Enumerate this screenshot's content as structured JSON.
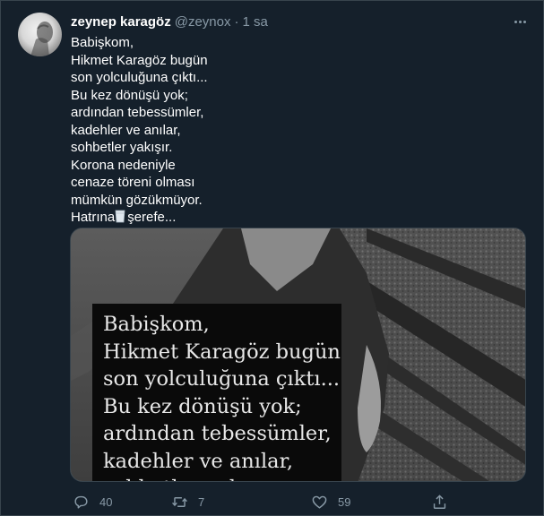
{
  "tweet": {
    "display_name": "zeynep karagöz",
    "handle": "@zeynox",
    "separator": "·",
    "time": "1 sa",
    "text_lines": [
      "Babişkom,",
      "Hikmet Karagöz bugün",
      "son yolculuğuna çıktı...",
      "Bu kez dönüşü yok;",
      "ardından tebessümler,",
      "kadehler ve anılar,",
      "sohbetler yakışır.",
      "Korona nedeniyle",
      "cenaze töreni olması",
      "mümkün gözükmüyor."
    ],
    "last_line_before_emoji": "Hatrına",
    "last_line_after_emoji": "şerefe...",
    "emoji": "glass-of-raki-icon"
  },
  "media": {
    "overlay_lines": [
      "Babişkom,",
      "Hikmet Karagöz bugün",
      "son yolculuğuna çıktı...",
      "Bu kez dönüşü yok;",
      "ardından tebessümler,",
      "kadehler ve anılar,",
      "sohbetler yakışır."
    ]
  },
  "actions": {
    "replies": "40",
    "retweets": "7",
    "likes": "59",
    "reply_icon": "reply-icon",
    "retweet_icon": "retweet-icon",
    "like_icon": "heart-icon",
    "share_icon": "share-icon"
  },
  "colors": {
    "background": "#15202b",
    "secondary_text": "#8899a6",
    "border": "#38444d"
  }
}
